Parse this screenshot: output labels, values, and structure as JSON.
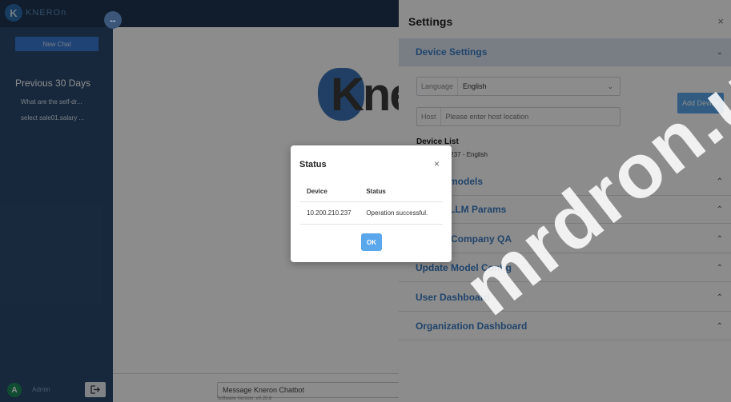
{
  "app": {
    "logo_text": "KNEROn",
    "logo_mark": "K",
    "new_chat_label": "New Chat",
    "collapse_icon": "↔",
    "history": {
      "title": "Previous 30 Days",
      "items": [
        "What are the self-dr...",
        "select sale01.salary ..."
      ]
    },
    "user": {
      "avatar_letter": "A",
      "name": "Admin",
      "logout_icon": "logout-icon"
    },
    "watermark_logo_text": "Kne",
    "chat_input_placeholder": "Message Kneron Chatbot",
    "software_version": "Software Version: v0.20.6"
  },
  "settings": {
    "title": "Settings",
    "close_icon": "×",
    "device_settings": {
      "label": "Device Settings",
      "language_label": "Language",
      "language_value": "English",
      "host_label": "Host",
      "host_placeholder": "Please enter host location",
      "add_device_label": "Add Device",
      "device_list_title": "Device List",
      "device_list_entry": "10.200.210.237 - English"
    },
    "sections": [
      "Switch models",
      "Modify LLM Params",
      "Update Company QA",
      "Update Model Config",
      "User Dashboard",
      "Organization Dashboard"
    ]
  },
  "modal": {
    "title": "Status",
    "close_icon": "×",
    "headers": [
      "Device",
      "Status"
    ],
    "rows": [
      [
        "10.200.210.237",
        "Operation successful."
      ]
    ],
    "ok_label": "OK"
  },
  "watermark_text": "mrdron.us"
}
